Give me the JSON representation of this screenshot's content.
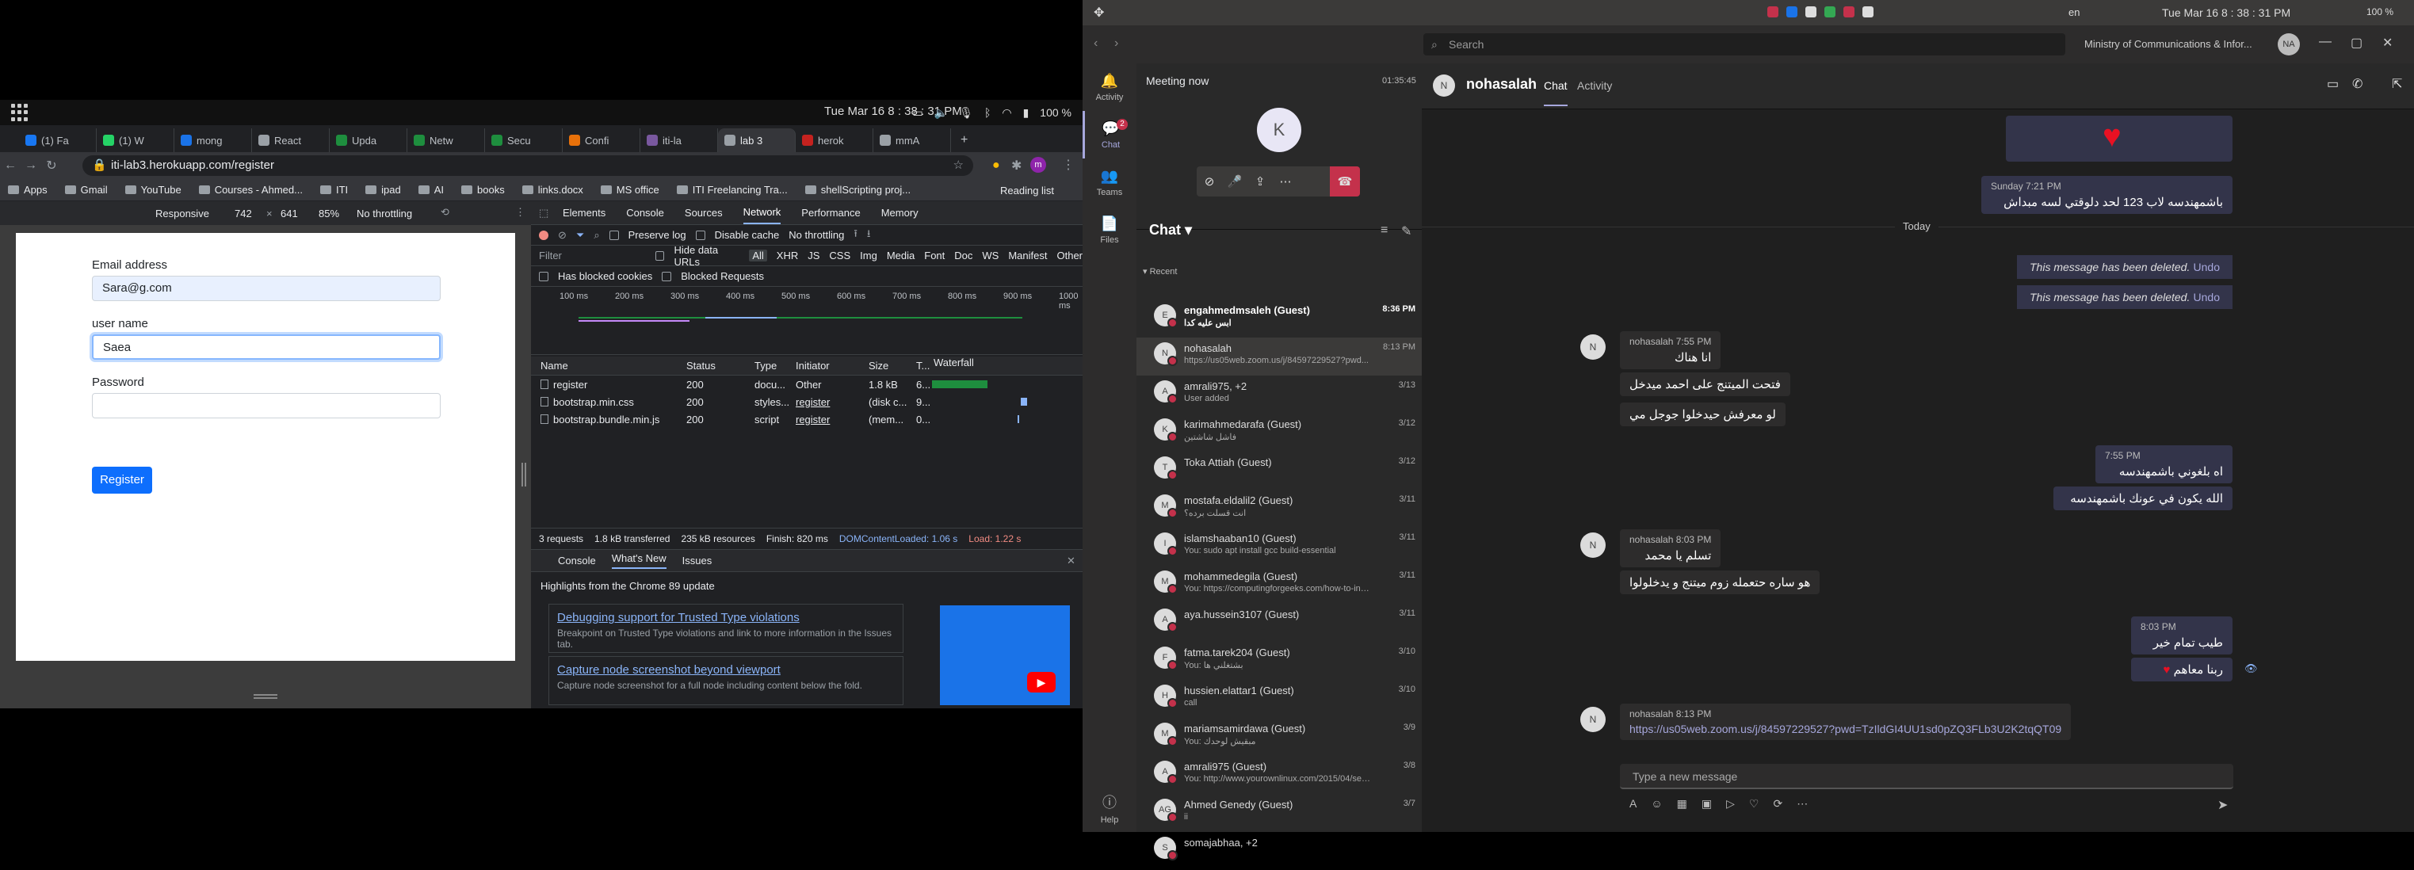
{
  "ubuntu": {
    "clock": "Tue Mar 16  8 : 38 : 31 PM",
    "battery": "100 %"
  },
  "browser": {
    "tabs": [
      {
        "label": "(1) Fa",
        "color": "#1877f2"
      },
      {
        "label": "(1) W",
        "color": "#25d366"
      },
      {
        "label": "mong",
        "color": "#1a73e8"
      },
      {
        "label": "React",
        "color": "#9aa0a6"
      },
      {
        "label": "Upda",
        "color": "#1e8e3e"
      },
      {
        "label": "Netw",
        "color": "#1e8e3e"
      },
      {
        "label": "Secu",
        "color": "#1e8e3e"
      },
      {
        "label": "Confi",
        "color": "#e8710a"
      },
      {
        "label": "iti-la",
        "color": "#79589f"
      },
      {
        "label": "lab 3",
        "color": "#9aa0a6"
      },
      {
        "label": "herok",
        "color": "#c5221f"
      },
      {
        "label": "mmA",
        "color": "#9aa0a6"
      }
    ],
    "url": "iti-lab3.herokuapp.com/register",
    "bookmarks": [
      "Apps",
      "Gmail",
      "YouTube",
      "Courses - Ahmed...",
      "ITI",
      "ipad",
      "AI",
      "books",
      "links.docx",
      "MS office",
      "ITI Freelancing Tra...",
      "shellScripting proj..."
    ],
    "reading_list": "Reading list"
  },
  "device_toolbar": {
    "mode": "Responsive",
    "width": "742",
    "height": "641",
    "zoom": "85%",
    "throttle": "No throttling"
  },
  "form": {
    "email_label": "Email address",
    "email_value": "Sara@g.com",
    "username_label": "user name",
    "username_value": "Saea",
    "password_label": "Password",
    "password_value": "",
    "submit": "Register"
  },
  "devtools": {
    "tabs": [
      "Elements",
      "Console",
      "Sources",
      "Network",
      "Performance",
      "Memory"
    ],
    "active_tab": "Network",
    "preserve_log": "Preserve log",
    "disable_cache": "Disable cache",
    "throttling": "No throttling",
    "filter_placeholder": "Filter",
    "hide_data_urls": "Hide data URLs",
    "types": [
      "All",
      "XHR",
      "JS",
      "CSS",
      "Img",
      "Media",
      "Font",
      "Doc",
      "WS",
      "Manifest",
      "Other"
    ],
    "has_blocked_cookies": "Has blocked cookies",
    "blocked_requests": "Blocked Requests",
    "timeline_ticks": [
      "100 ms",
      "200 ms",
      "300 ms",
      "400 ms",
      "500 ms",
      "600 ms",
      "700 ms",
      "800 ms",
      "900 ms",
      "1000 ms"
    ],
    "columns": [
      "Name",
      "Status",
      "Type",
      "Initiator",
      "Size",
      "T...",
      "Waterfall"
    ],
    "rows": [
      {
        "name": "register",
        "status": "200",
        "type": "docu...",
        "initiator": "Other",
        "size": "1.8 kB",
        "time": "6..."
      },
      {
        "name": "bootstrap.min.css",
        "status": "200",
        "type": "styles...",
        "initiator": "register",
        "size": "(disk c...",
        "time": "9..."
      },
      {
        "name": "bootstrap.bundle.min.js",
        "status": "200",
        "type": "script",
        "initiator": "register",
        "size": "(mem...",
        "time": "0..."
      }
    ],
    "summary": {
      "requests": "3 requests",
      "transferred": "1.8 kB transferred",
      "resources": "235 kB resources",
      "finish": "Finish: 820 ms",
      "dcl": "DOMContentLoaded: 1.06 s",
      "load": "Load: 1.22 s"
    },
    "drawer_tabs": [
      "Console",
      "What's New",
      "Issues"
    ],
    "drawer_heading": "Highlights from the Chrome 89 update",
    "cards": [
      {
        "title": "Debugging support for Trusted Type violations",
        "desc": "Breakpoint on Trusted Type violations and link to more information in the Issues tab."
      },
      {
        "title": "Capture node screenshot beyond viewport",
        "desc": "Capture node screenshot for a full node including content below the fold."
      }
    ]
  },
  "teams": {
    "search_placeholder": "Search",
    "org": "Ministry of Communications & Infor...",
    "user_initials": "NA",
    "clock": "Tue Mar 16  8 : 38 : 31 PM",
    "lang": "en",
    "rail": [
      {
        "label": "Activity",
        "icon": "bell-icon"
      },
      {
        "label": "Chat",
        "icon": "chat-icon",
        "badge": "2"
      },
      {
        "label": "Teams",
        "icon": "teams-icon"
      },
      {
        "label": "Files",
        "icon": "file-icon"
      },
      {
        "label": "Help",
        "icon": "help-icon"
      }
    ],
    "meeting": {
      "title": "Meeting now",
      "time": "01:35:45",
      "avatar": "K"
    },
    "chat_header": "Chat",
    "recent": "Recent",
    "chats": [
      {
        "name": "engahmedmsaleh (Guest)",
        "preview": "ابس عليه كدا",
        "time": "8:36 PM",
        "initials": "E",
        "bold": true
      },
      {
        "name": "nohasalah",
        "preview": "https://us05web.zoom.us/j/84597229527?pwd...",
        "time": "8:13 PM",
        "initials": "N"
      },
      {
        "name": "amrali975, +2",
        "preview": "User added",
        "time": "3/13",
        "initials": "A"
      },
      {
        "name": "karimahmedarafa (Guest)",
        "preview": "فاشل شاشتين",
        "time": "3/12",
        "initials": "K"
      },
      {
        "name": "Toka Attiah (Guest)",
        "preview": "",
        "time": "3/12",
        "initials": "T"
      },
      {
        "name": "mostafa.eldalil2 (Guest)",
        "preview": "انت قسلت برده؟",
        "time": "3/11",
        "initials": "M"
      },
      {
        "name": "islamshaaban10 (Guest)",
        "preview": "You: sudo apt install gcc build-essential",
        "time": "3/11",
        "initials": "I"
      },
      {
        "name": "mohammedegila (Guest)",
        "preview": "You: https://computingforgeeks.com/how-to-inst...",
        "time": "3/11",
        "initials": "M"
      },
      {
        "name": "aya.hussein3107 (Guest)",
        "preview": "",
        "time": "3/11",
        "initials": "A"
      },
      {
        "name": "fatma.tarek204 (Guest)",
        "preview": "You: بشتغلني ها",
        "time": "3/10",
        "initials": "F"
      },
      {
        "name": "hussien.elattar1 (Guest)",
        "preview": "call",
        "time": "3/10",
        "initials": "H"
      },
      {
        "name": "mariamsamirdawa (Guest)",
        "preview": "You: مبقيش لوحدك",
        "time": "3/9",
        "initials": "M"
      },
      {
        "name": "amrali975 (Guest)",
        "preview": "You: http://www.yourownlinux.com/2015/04/sed-...",
        "time": "3/8",
        "initials": "A"
      },
      {
        "name": "Ahmed Genedy (Guest)",
        "preview": "ii",
        "time": "3/7",
        "initials": "AG"
      },
      {
        "name": "somajabhaa, +2",
        "preview": "",
        "time": "",
        "initials": "S"
      }
    ],
    "conversation": {
      "name": "nohasalah",
      "tabs": [
        "Chat",
        "Activity"
      ],
      "initials": "N",
      "top_msg_meta": "Sunday 7:21 PM",
      "top_msg": "باشمهندسه لاب 123 لحد دلوقتي لسه مبداش",
      "today": "Today",
      "deleted": "This message has been deleted.",
      "undo": "Undo",
      "in1_meta": "nohasalah   7:55 PM",
      "in1": [
        "انا هناك",
        "فتحت الميتنج على احمد ميدخل",
        "لو معرفش حيدخلوا جوجل مي"
      ],
      "out1_meta": "7:55 PM",
      "out1": [
        "اه بلغوني باشمهندسه",
        "الله يكون في عونك باشمهندسه"
      ],
      "in2_meta": "nohasalah   8:03 PM",
      "in2": [
        "تسلم يا محمد",
        "هو ساره حتعمله زوم ميتنج و يدخلولوا"
      ],
      "out2_meta": "8:03 PM",
      "out2": [
        "طيب تمام خير",
        "ربنا معاهم"
      ],
      "in3_meta": "nohasalah   8:13 PM",
      "in3_link": "https://us05web.zoom.us/j/84597229527?pwd=TzIldGI4UU1sd0pZQ3FLb3U2K2tqQT09",
      "composer_placeholder": "Type a new message"
    }
  }
}
